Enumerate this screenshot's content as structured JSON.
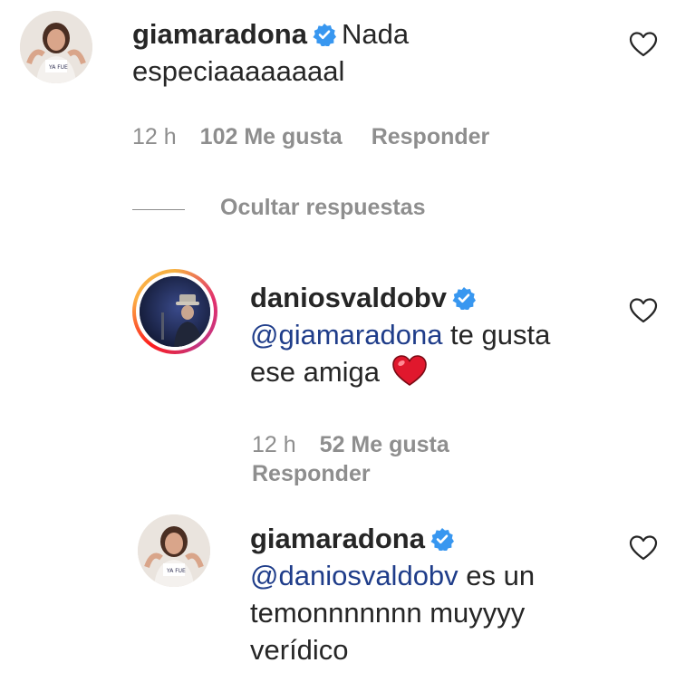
{
  "comments": [
    {
      "username": "giamaradona",
      "text": "Nada especiaaaaaaaal",
      "time": "12 h",
      "likes": "102 Me gusta",
      "reply": "Responder"
    },
    {
      "username": "daniosvaldobv",
      "mention": "@giamaradona",
      "text_a": " te gusta",
      "text_b": "ese amiga",
      "emoji": "red-heart",
      "time": "12 h",
      "likes": "52 Me gusta",
      "reply": "Responder"
    },
    {
      "username": "giamaradona",
      "mention": "@daniosvaldobv",
      "text_a": " es un",
      "text_b": "temonnnnnnn muyyyy",
      "text_c": "verídico"
    }
  ],
  "replies_toggle": "Ocultar respuestas",
  "icons": {
    "verified": "verified-badge-icon",
    "like": "heart-outline-icon"
  },
  "colors": {
    "verified": "#3897f0",
    "mention": "#1f3d8a",
    "muted": "#8e8e8e",
    "heart_emoji": "#e0182d"
  }
}
